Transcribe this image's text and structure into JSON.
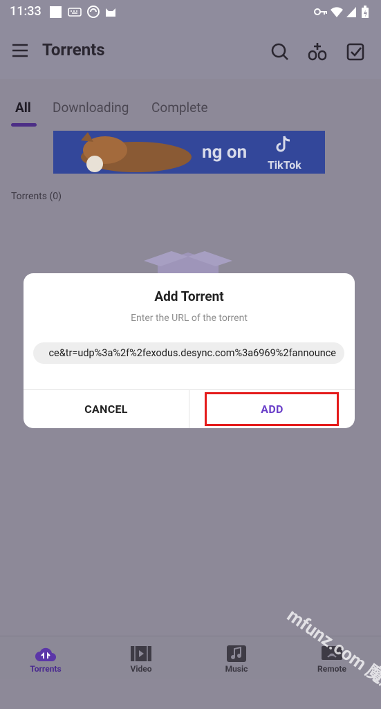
{
  "status_bar": {
    "time": "11:33",
    "icons": [
      "square-icon",
      "keyboard-icon",
      "browser-icon",
      "cat-icon",
      "key-icon",
      "wifi-icon",
      "signal-icon",
      "battery-icon"
    ]
  },
  "app_bar": {
    "title": "Torrents",
    "icons": [
      "menu-icon",
      "search-icon",
      "add-torrent-icon",
      "select-icon"
    ]
  },
  "tabs": [
    {
      "label": "All",
      "active": true
    },
    {
      "label": "Downloading",
      "active": false
    },
    {
      "label": "Complete",
      "active": false
    }
  ],
  "ad": {
    "headline": "ng on",
    "brand": "TikTok"
  },
  "torrent_count_label": "Torrents (0)",
  "dialog": {
    "title": "Add Torrent",
    "subtitle": "Enter the URL of the torrent",
    "url_value": "ce&tr=udp%3a%2f%2fexodus.desync.com%3a6969%2fannounce",
    "cancel_label": "CANCEL",
    "add_label": "ADD"
  },
  "bottom_nav": [
    {
      "label": "Torrents",
      "icon": "cloud-upload-icon",
      "active": true
    },
    {
      "label": "Video",
      "icon": "film-icon",
      "active": false
    },
    {
      "label": "Music",
      "icon": "music-icon",
      "active": false
    },
    {
      "label": "Remote",
      "icon": "remote-icon",
      "active": false
    }
  ],
  "watermark": "mfunz.com 魔趣网",
  "colors": {
    "accent": "#6a3fc9",
    "highlight": "#e41b1b",
    "overlay": "#8d8998"
  }
}
